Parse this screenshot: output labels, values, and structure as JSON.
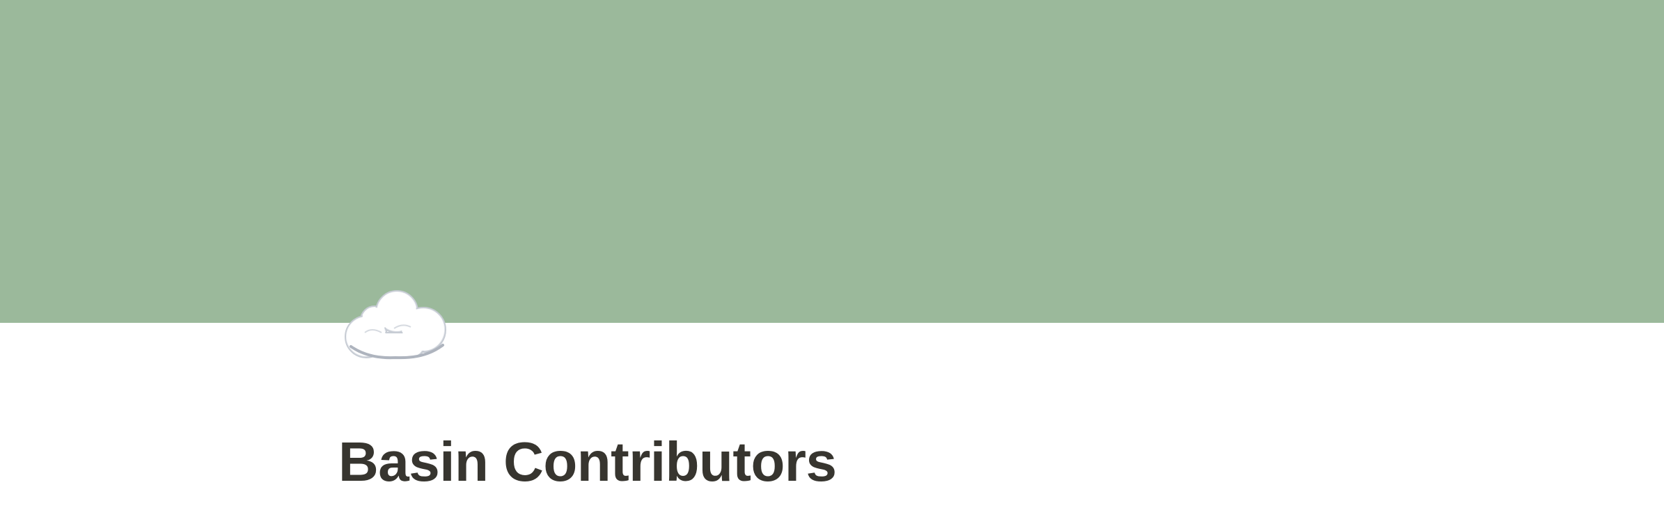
{
  "page": {
    "title": "Basin Contributors",
    "icon": "cloud-icon",
    "cover_color": "#9bb99b",
    "title_color": "#37352f"
  }
}
